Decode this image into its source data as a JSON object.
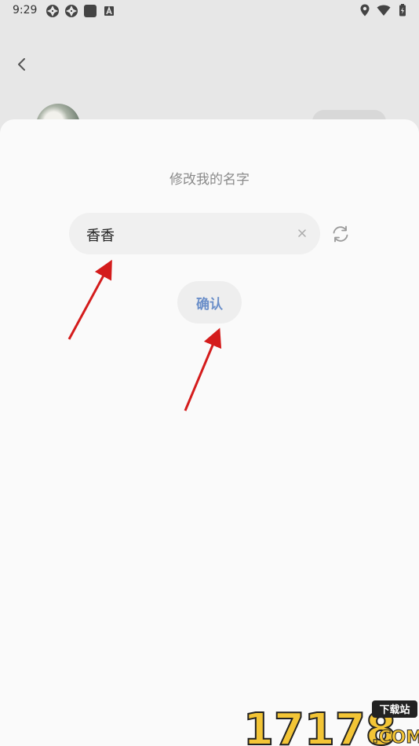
{
  "status_bar": {
    "time": "9:29",
    "left_icons": [
      "aperture-icon",
      "aperture-icon",
      "stop-square-icon",
      "a-badge-icon"
    ],
    "right_icons": [
      "location-icon",
      "wifi-icon",
      "battery-charging-icon"
    ]
  },
  "header": {
    "back_icon": "chevron-left-icon"
  },
  "dialog": {
    "title": "修改我的名字",
    "name_input": {
      "value": "香香",
      "placeholder": ""
    },
    "clear_icon": "close-icon",
    "refresh_icon": "refresh-icon",
    "confirm_label": "确认"
  },
  "watermark": {
    "text": "17178",
    "badge": "下载站",
    "suffix": ".COM"
  },
  "colors": {
    "background": "#e7e7e7",
    "sheet": "#fafafa",
    "input_bg": "#f0f0f0",
    "confirm_text": "#6b8fc9",
    "annotation_arrow": "#d41c1c"
  }
}
